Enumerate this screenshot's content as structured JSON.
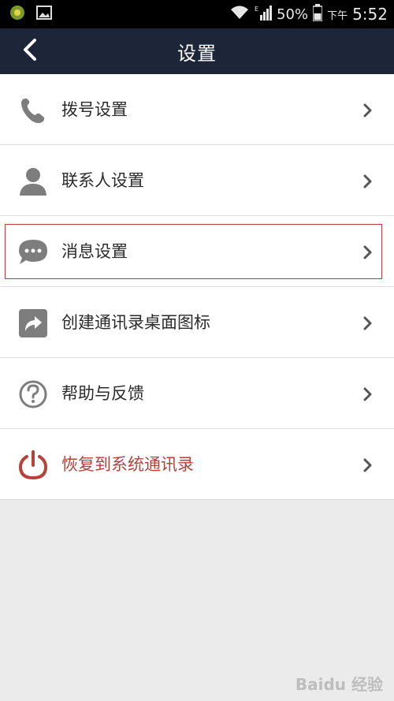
{
  "status_bar": {
    "battery": "50%",
    "ampm": "下午",
    "time": "5:52",
    "icons": [
      "app-coin-icon",
      "image-icon",
      "wifi-icon",
      "signal-icon",
      "battery-icon"
    ]
  },
  "header": {
    "title": "设置"
  },
  "menu": {
    "items": [
      {
        "label": "拨号设置",
        "icon": "phone-icon"
      },
      {
        "label": "联系人设置",
        "icon": "person-icon"
      },
      {
        "label": "消息设置",
        "icon": "chat-bubble-icon"
      },
      {
        "label": "创建通讯录桌面图标",
        "icon": "share-arrow-icon"
      },
      {
        "label": "帮助与反馈",
        "icon": "help-icon"
      },
      {
        "label": "恢复到系统通讯录",
        "icon": "power-icon"
      }
    ]
  },
  "watermark": "Baidu 经验",
  "colors": {
    "titlebar": "#1c2638",
    "danger": "#b4433a",
    "highlight": "#c0393b"
  }
}
